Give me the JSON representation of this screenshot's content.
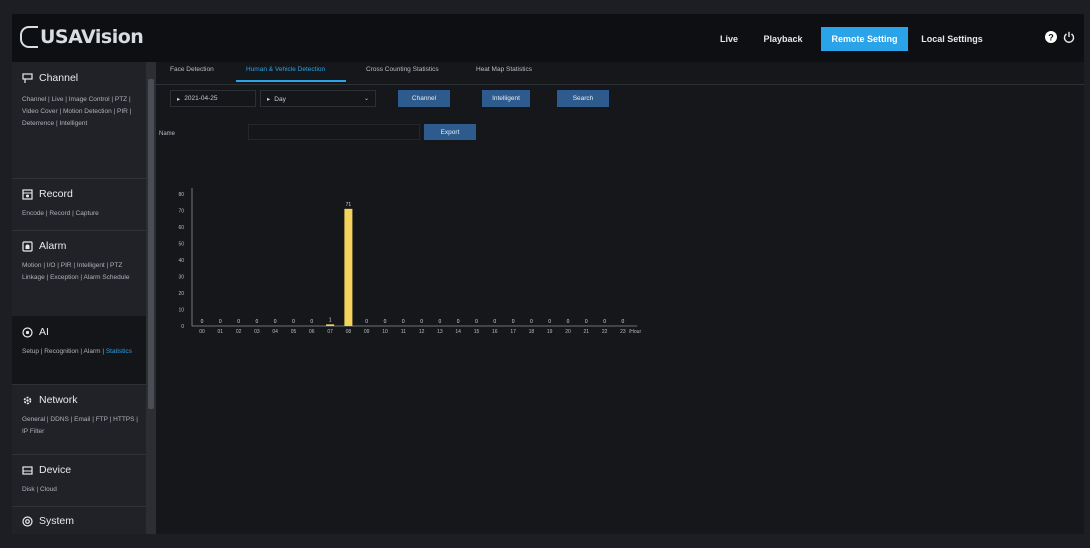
{
  "brand": {
    "logo_text": "USAVision"
  },
  "topnav": [
    {
      "label": "Live",
      "active": false
    },
    {
      "label": "Playback",
      "active": false
    },
    {
      "label": "Remote Setting",
      "active": true
    },
    {
      "label": "Local Settings",
      "active": false
    }
  ],
  "sidebar": [
    {
      "title": "Channel",
      "icon": "channel-icon",
      "links": "Channel | Live | Image Control | PTZ | Video Cover | Motion Detection | PIR | Deterrence | Intelligent"
    },
    {
      "title": "Record",
      "icon": "record-icon",
      "links": "Encode | Record | Capture"
    },
    {
      "title": "Alarm",
      "icon": "alarm-icon",
      "links": "Motion | I/O | PIR | Intelligent | PTZ Linkage | Exception | Alarm Schedule"
    },
    {
      "title": "AI",
      "icon": "ai-icon",
      "links_pre": "Setup | Recognition | Alarm | ",
      "links_active": "Statistics"
    },
    {
      "title": "Network",
      "icon": "network-icon",
      "links": "General | DDNS | Email | FTP | HTTPS | IP Filter"
    },
    {
      "title": "Device",
      "icon": "device-icon",
      "links": "Disk | Cloud"
    },
    {
      "title": "System",
      "icon": "system-icon"
    }
  ],
  "tabs": [
    {
      "label": "Face Detection",
      "active": false
    },
    {
      "label": "Human & Vehicle Detection",
      "active": true
    },
    {
      "label": "Cross Counting Statistics",
      "active": false
    },
    {
      "label": "Heat Map Statistics",
      "active": false
    }
  ],
  "controls": {
    "date": "2021-04-25",
    "period": "Day",
    "channel_button": "Channel",
    "intelligent_button": "Intelligent",
    "search_button": "Search",
    "name_label": "Name",
    "name_value": "",
    "export_button": "Export"
  },
  "chart_data": {
    "type": "bar",
    "categories": [
      "00",
      "01",
      "02",
      "03",
      "04",
      "05",
      "06",
      "07",
      "08",
      "09",
      "10",
      "11",
      "12",
      "13",
      "14",
      "15",
      "16",
      "17",
      "18",
      "19",
      "20",
      "21",
      "22",
      "23"
    ],
    "values": [
      0,
      0,
      0,
      0,
      0,
      0,
      0,
      1,
      71,
      0,
      0,
      0,
      0,
      0,
      0,
      0,
      0,
      0,
      0,
      0,
      0,
      0,
      0,
      0
    ],
    "ylim": [
      0,
      80
    ],
    "yticks": [
      0,
      10,
      20,
      30,
      40,
      50,
      60,
      70,
      80
    ],
    "x_unit": "/Hour",
    "bar_color": "#f3d35b",
    "grid": false
  }
}
